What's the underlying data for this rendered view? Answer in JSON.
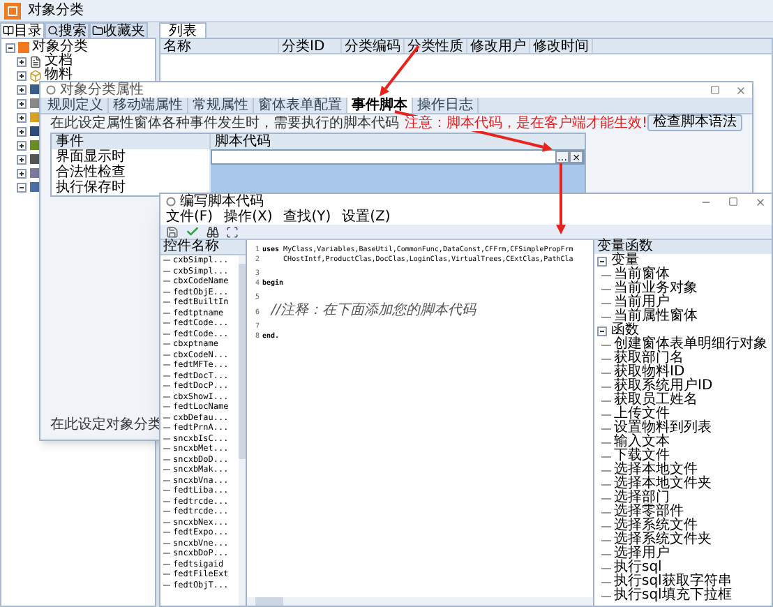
{
  "window": {
    "title": "对象分类"
  },
  "left_tabs": [
    {
      "label": "目录",
      "selected": true
    },
    {
      "label": "搜索",
      "selected": false
    },
    {
      "label": "收藏夹",
      "selected": false
    }
  ],
  "tree": {
    "label": "对象分类",
    "expanded": true,
    "children": [
      {
        "label": "文档",
        "expanded": false
      },
      {
        "label": "物料",
        "expanded": false
      },
      {
        "expanded": false
      },
      {
        "expanded": false
      },
      {
        "expanded": false
      },
      {
        "expanded": false
      },
      {
        "expanded": false
      },
      {
        "expanded": false
      },
      {
        "expanded": false
      },
      {
        "expanded": true
      }
    ]
  },
  "list_tab": {
    "label": "列表",
    "selected": true
  },
  "table": {
    "columns": [
      "名称",
      "分类ID",
      "分类编码",
      "分类性质",
      "修改用户",
      "修改时间"
    ]
  },
  "property_dialog": {
    "title": "对象分类属性",
    "tabs": [
      {
        "label": "规则定义",
        "selected": false
      },
      {
        "label": "移动端属性",
        "selected": false
      },
      {
        "label": "常规属性",
        "selected": false
      },
      {
        "label": "窗体表单配置",
        "selected": false
      },
      {
        "label": "事件脚本",
        "selected": true
      },
      {
        "label": "操作日志",
        "selected": false
      }
    ],
    "instruction": "在此设定属性窗体各种事件发生时，需要执行的脚本代码",
    "warning": "注意：脚本代码，是在客户端才能生效!",
    "check_button": "检查脚本语法",
    "grid": {
      "columns": [
        "事件",
        "脚本代码"
      ],
      "rows": [
        {
          "event": "界面显示时",
          "selected": false,
          "buttons": [
            "…",
            "×"
          ]
        },
        {
          "event": "合法性检查",
          "selected": true
        },
        {
          "event": "执行保存时",
          "selected": true
        }
      ]
    },
    "footer": "在此设定对象分类"
  },
  "script_editor": {
    "title": "编写脚本代码",
    "menu": [
      "文件(F)",
      "操作(X)",
      "查找(Y)",
      "设置(Z)"
    ],
    "controls_header": "控件名称",
    "controls": [
      "cxbSimpl...",
      "cxbSimpl...",
      "cbxCodeName",
      "fedtObjE...",
      "fedtBuiltIn",
      "fedtptname",
      "fedtCode...",
      "fedtCode...",
      "cbxptname",
      "cbxCodeN...",
      "fedtMFTe...",
      "fedtDocT...",
      "fedtDocP...",
      "cbxShowI...",
      "fedtLocName",
      "cxbDefau...",
      "fedtPrnA...",
      "sncxbIsC...",
      "sncxbMet...",
      "sncxbDoD...",
      "sncxbMak...",
      "sncxbVna...",
      "fedtLiba...",
      "fedtrcde...",
      "fedtrcde...",
      "sncxbNex...",
      "fedtExpo...",
      "sncxbVne...",
      "sncxbDoP...",
      "fedtsigaid",
      "fedtFileExt",
      "fedtObjT..."
    ],
    "code_lines": [
      {
        "number": "1",
        "kind": "code",
        "text": "**uses** MyClass,Variables,BaseUtil,CommonFunc,DataConst,CFFrm,CFSimplePropFrm"
      },
      {
        "number": "2",
        "kind": "code",
        "text": "     CHostIntf,ProductClas,DocClas,LoginClas,VirtualTrees,CExtClas,PathCla"
      },
      {
        "number": "3",
        "kind": "code"
      },
      {
        "number": "4",
        "kind": "code",
        "text": "**begin**"
      },
      {
        "number": "5",
        "kind": "code"
      },
      {
        "number": "6",
        "kind": "comment",
        "text": "  //注释：在下面添加您的脚本代码"
      },
      {
        "number": "7",
        "kind": "code"
      },
      {
        "number": "8",
        "kind": "code",
        "text": "**end.**"
      }
    ],
    "functions_header": "变量函数",
    "functions_tree": [
      {
        "label": "变量",
        "expanded": true,
        "children": [
          {
            "label": "当前窗体"
          },
          {
            "label": "当前业务对象"
          },
          {
            "label": "当前用户"
          },
          {
            "label": "当前属性窗体"
          }
        ]
      },
      {
        "label": "函数",
        "expanded": true,
        "children": [
          {
            "label": "创建窗体表单明细行对象"
          },
          {
            "label": "获取部门名"
          },
          {
            "label": "获取物料ID"
          },
          {
            "label": "获取系统用户ID"
          },
          {
            "label": "获取员工姓名"
          },
          {
            "label": "上传文件"
          },
          {
            "label": "设置物料到列表"
          },
          {
            "label": "输入文本"
          },
          {
            "label": "下载文件"
          },
          {
            "label": "选择本地文件"
          },
          {
            "label": "选择本地文件夹"
          },
          {
            "label": "选择部门"
          },
          {
            "label": "选择零部件"
          },
          {
            "label": "选择系统文件"
          },
          {
            "label": "选择系统文件夹"
          },
          {
            "label": "选择用户"
          },
          {
            "label": "执行sql"
          },
          {
            "label": "执行sql获取字符串"
          },
          {
            "label": "执行sql填充下拉框"
          }
        ]
      }
    ]
  }
}
